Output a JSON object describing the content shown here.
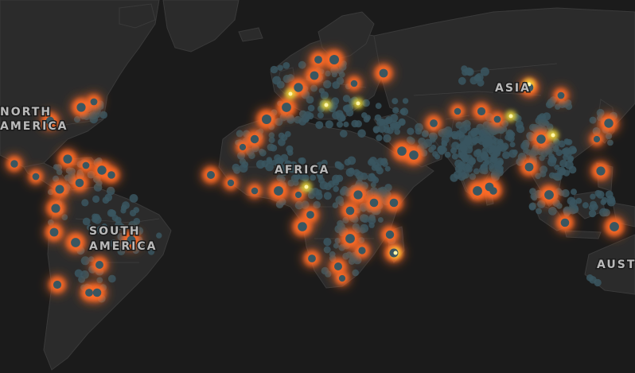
{
  "map": {
    "labels": {
      "north_america": [
        "NORTH",
        "AMERICA"
      ],
      "south_america": [
        "SOUTH",
        "AMERICA"
      ],
      "africa": "AFRICA",
      "asia": "ASIA",
      "australia": "AUST"
    },
    "colors": {
      "ocean": "#1b1b1b",
      "land": "#2b2b2b",
      "border": "#3a3a3a",
      "dot": "#3a5660",
      "glow_orange": "#ff6a26",
      "glow_yellow": "#f5e23a"
    },
    "legend_visible": false
  }
}
